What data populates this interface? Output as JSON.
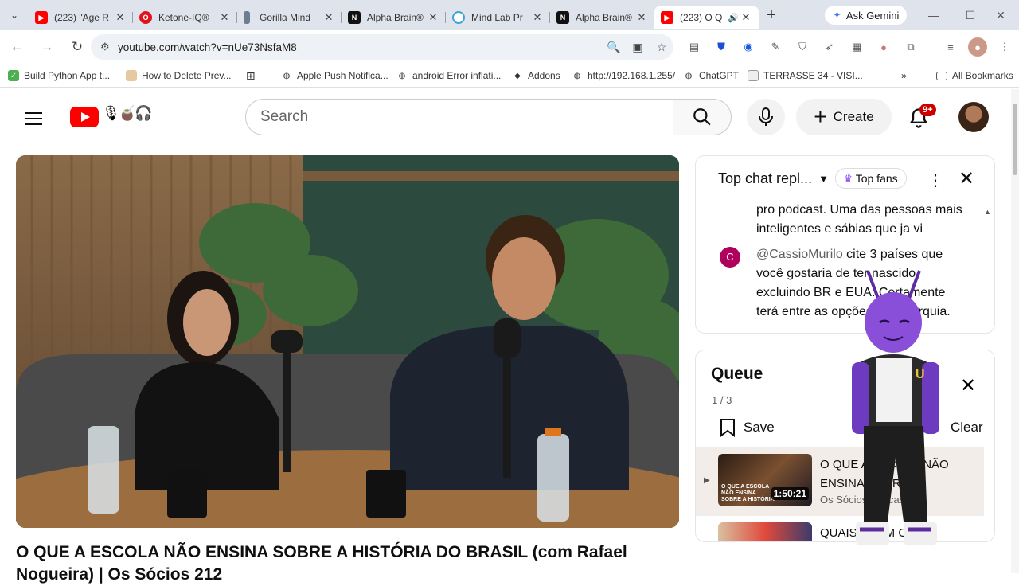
{
  "browser": {
    "tabs": [
      {
        "title": "(223) \"Age R",
        "icon": "youtube-icon",
        "color": "#ff0000"
      },
      {
        "title": "Ketone-IQ®",
        "icon": "opera-icon",
        "color": "#e0121c"
      },
      {
        "title": "Gorilla Mind",
        "icon": "bottle-icon",
        "color": "#6b7c93"
      },
      {
        "title": "Alpha Brain®",
        "icon": "onnit-icon",
        "color": "#111111"
      },
      {
        "title": "Mind Lab Pr",
        "icon": "mindlab-icon",
        "color": "#3aa6d8"
      },
      {
        "title": "Alpha Brain®",
        "icon": "onnit-icon",
        "color": "#111111"
      },
      {
        "title": "(223) O Q",
        "icon": "youtube-icon",
        "color": "#ff0000"
      }
    ],
    "gemini_label": "Ask Gemini",
    "url": "youtube.com/watch?v=nUe73NsfaM8",
    "bookmarks": [
      {
        "label": "Build Python App t...",
        "icon": "bookmark-green-icon"
      },
      {
        "label": "How to Delete Prev...",
        "icon": "bookmark-tan-icon"
      },
      {
        "label": "Apple Push Notifica...",
        "icon": "globe-icon"
      },
      {
        "label": "android Error inflati...",
        "icon": "globe-icon"
      },
      {
        "label": "Addons",
        "icon": "diamond-icon"
      },
      {
        "label": "http://192.168.1.255/",
        "icon": "globe-icon"
      },
      {
        "label": "ChatGPT",
        "icon": "globe-icon"
      },
      {
        "label": "TERRASSE 34 - VISI...",
        "icon": "doc-icon"
      }
    ],
    "all_bookmarks": "All Bookmarks",
    "more_bookmarks": "»"
  },
  "youtube": {
    "search_placeholder": "Search",
    "create_label": "Create",
    "notif_badge": "9+",
    "video_title": "O QUE A ESCOLA NÃO ENSINA SOBRE A HISTÓRIA DO BRASIL (com Rafael Nogueira) | Os Sócios 212",
    "accent": "#ff0000"
  },
  "chat": {
    "mode_label": "Top chat repl...",
    "top_fans": "Top fans",
    "messages": [
      {
        "text": "pro podcast. Uma das pessoas mais inteligentes e sábias que ja vi",
        "author": ""
      },
      {
        "author": "@CassioMurilo",
        "avatar_letter": "C",
        "text": "cite 3 países que você gostaria de ter nascido excluindo BR e EUA. Certamente terá entre as opções a monarquia."
      }
    ]
  },
  "queue": {
    "title": "Queue",
    "count": "1 / 3",
    "save_label": "Save",
    "clear_label": "Clear",
    "items": [
      {
        "title": "O QUE A ESCOLA NÃO ENSINA SOBRE...",
        "channel": "Os Sócios Podcast",
        "duration": "1:50:21",
        "thumb_text": "O QUE A ESCOLA NÃO ENSINA SOBRE A HISTÓRIA"
      },
      {
        "title": "QUAIS ERAM OS...",
        "channel": "",
        "duration": ""
      }
    ]
  }
}
